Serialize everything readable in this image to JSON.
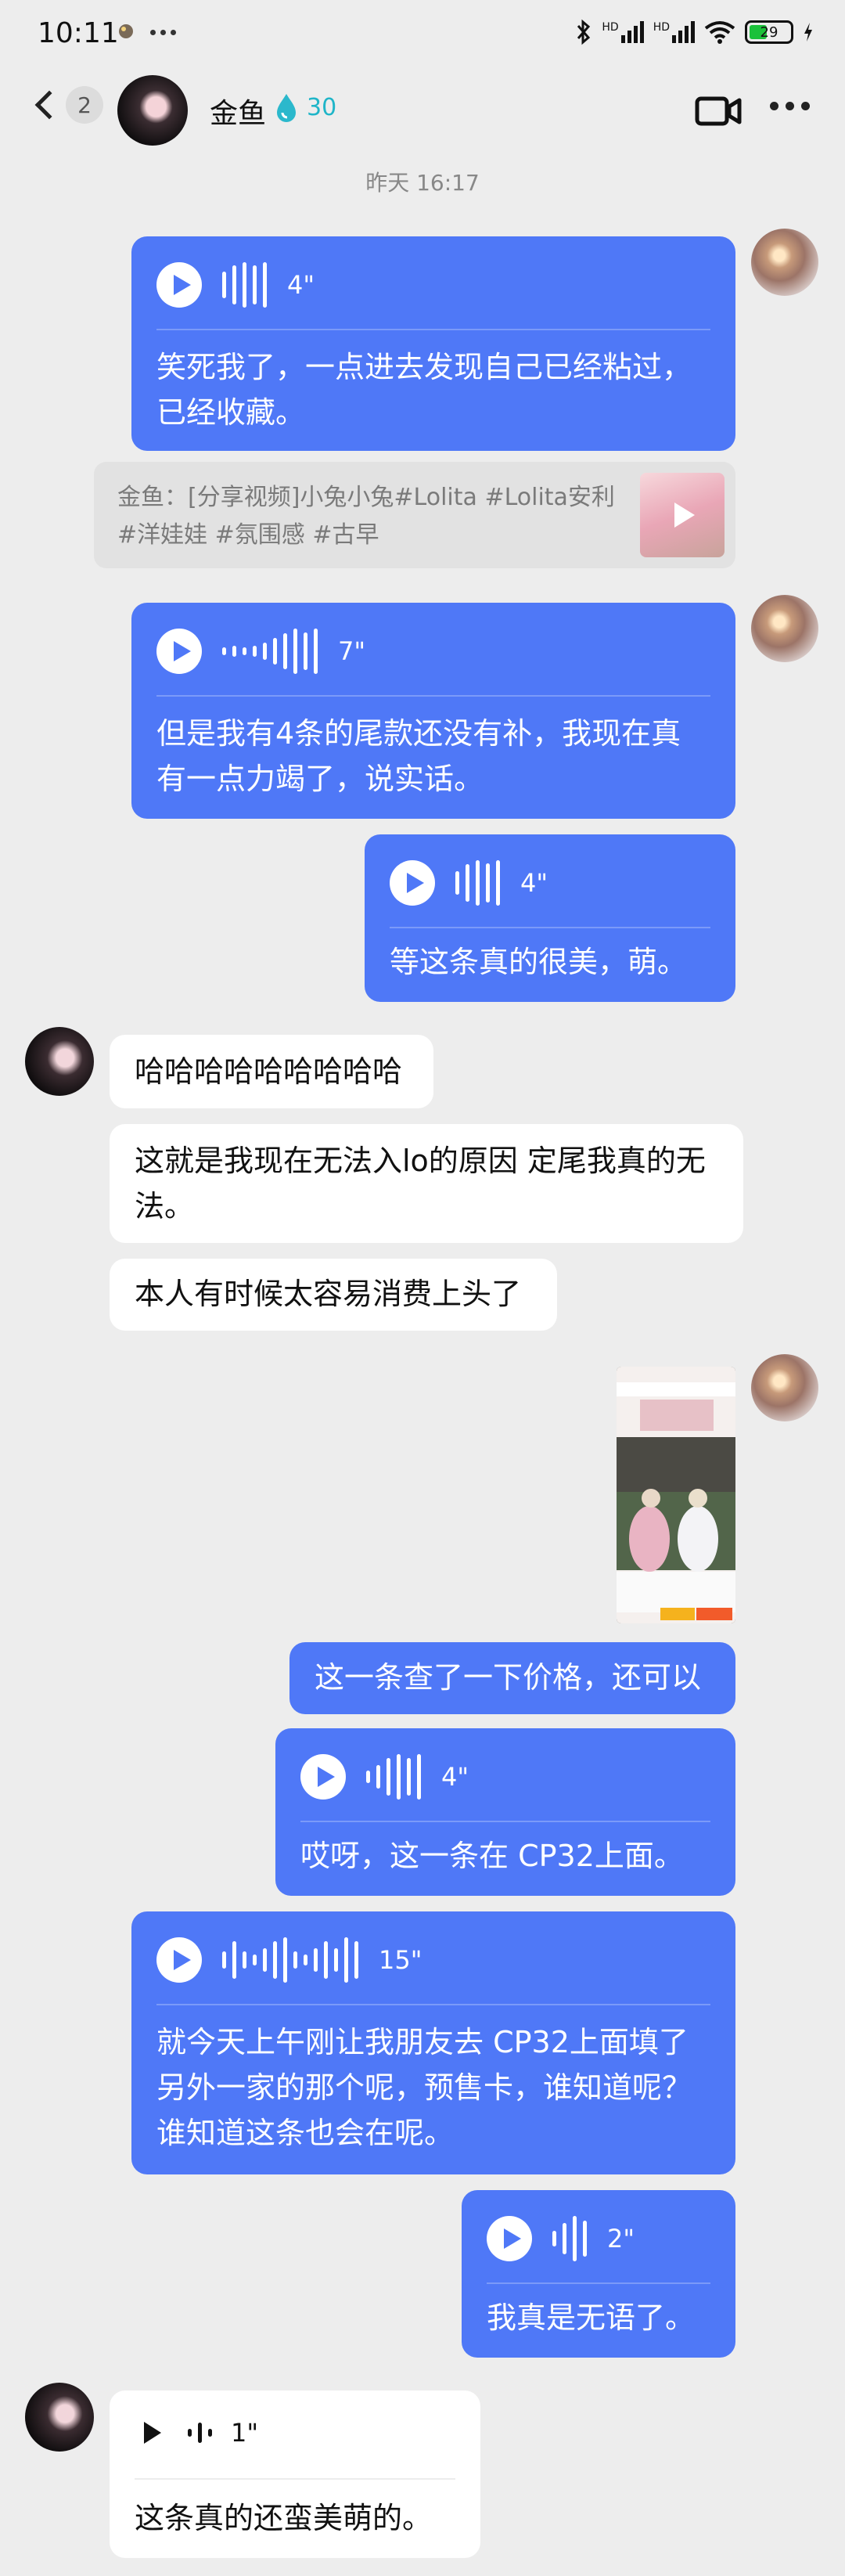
{
  "status_bar": {
    "time": "10:11",
    "icons": [
      "bug-icon",
      "more-dots-icon",
      "bluetooth-icon",
      "hd-signal-icon",
      "hd-signal-icon",
      "wifi-icon",
      "battery-icon",
      "charging-icon"
    ],
    "hd1": "HD",
    "hd2": "HD",
    "battery": "29"
  },
  "header": {
    "back_count": "2",
    "contact_name": "金鱼",
    "intimacy_value": "30",
    "accent": "#1fb5c8"
  },
  "timestamp": "昨天 16:17",
  "colors": {
    "bubble_blue": "#4f78f7",
    "background": "#ededed"
  },
  "messages": [
    {
      "sender": "me",
      "type": "voice",
      "duration": "4\"",
      "transcript": "笑死我了，一点进去发现自己已经粘过，已经收藏。"
    },
    {
      "type": "quote",
      "text": "金鱼：[分享视频]小兔小兔#Lolita #Lolita安利 #洋娃娃 #氛围感 #古早"
    },
    {
      "sender": "me",
      "type": "voice",
      "duration": "7\"",
      "transcript": "但是我有4条的尾款还没有补，我现在真有一点力竭了，说实话。"
    },
    {
      "sender": "me",
      "type": "voice",
      "duration": "4\"",
      "transcript": "等这条真的很美，萌。"
    },
    {
      "sender": "other",
      "type": "text",
      "text": "哈哈哈哈哈哈哈哈哈"
    },
    {
      "sender": "other",
      "type": "text",
      "text": "这就是我现在无法入lo的原因 定尾我真的无法。"
    },
    {
      "sender": "other",
      "type": "text",
      "text": "本人有时候太容易消费上头了"
    },
    {
      "sender": "me",
      "type": "image",
      "description": "shared screenshot"
    },
    {
      "sender": "me",
      "type": "text",
      "text": "这一条查了一下价格，还可以"
    },
    {
      "sender": "me",
      "type": "voice",
      "duration": "4\"",
      "transcript": "哎呀，这一条在 CP32上面。"
    },
    {
      "sender": "me",
      "type": "voice",
      "duration": "15\"",
      "transcript": "就今天上午刚让我朋友去 CP32上面填了另外一家的那个呢，预售卡，谁知道呢？谁知道这条也会在呢。"
    },
    {
      "sender": "me",
      "type": "voice",
      "duration": "2\"",
      "transcript": "我真是无语了。"
    },
    {
      "sender": "other",
      "type": "voice",
      "duration": "1\"",
      "transcript": "这条真的还蛮美萌的。"
    }
  ]
}
